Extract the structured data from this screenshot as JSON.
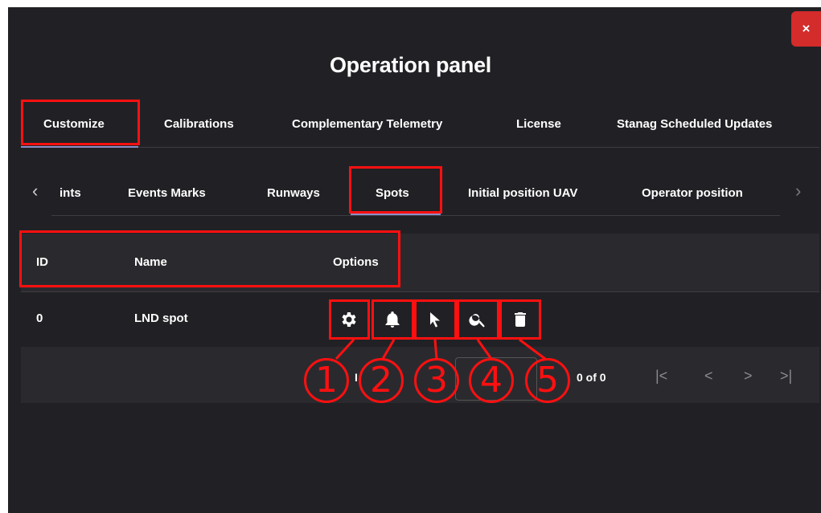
{
  "window": {
    "title": "Operation panel",
    "close_label": "×"
  },
  "top_tabs": [
    {
      "label": "Customize",
      "active": true
    },
    {
      "label": "Calibrations"
    },
    {
      "label": "Complementary Telemetry"
    },
    {
      "label": "License"
    },
    {
      "label": "Stanag Scheduled Updates"
    }
  ],
  "sub_tabs": {
    "prev_icon": "chevron-left-icon",
    "next_icon": "chevron-right-icon",
    "items": [
      {
        "label": "ints"
      },
      {
        "label": "Events Marks"
      },
      {
        "label": "Runways"
      },
      {
        "label": "Spots",
        "active": true
      },
      {
        "label": "Initial position UAV"
      },
      {
        "label": "Operator position"
      }
    ]
  },
  "table": {
    "headers": {
      "id": "ID",
      "name": "Name",
      "options": "Options"
    },
    "rows": [
      {
        "id": "0",
        "name": "LND spot"
      }
    ],
    "option_icons": [
      "gear-icon",
      "bell-icon",
      "cursor-icon",
      "search-icon",
      "trash-icon"
    ]
  },
  "paginator": {
    "items_label_fragment": "I",
    "range_label": "0 of 0",
    "first_label": "|<",
    "prev_label": "<",
    "next_label": ">",
    "last_label": ">|"
  },
  "callouts": [
    "1",
    "2",
    "3",
    "4",
    "5"
  ],
  "colors": {
    "panel_bg": "#212125",
    "header_bg": "#2a2a2e",
    "close_button": "#d42b2b",
    "highlight": "#ff1010",
    "active_indicator": "#8d8dc8"
  }
}
